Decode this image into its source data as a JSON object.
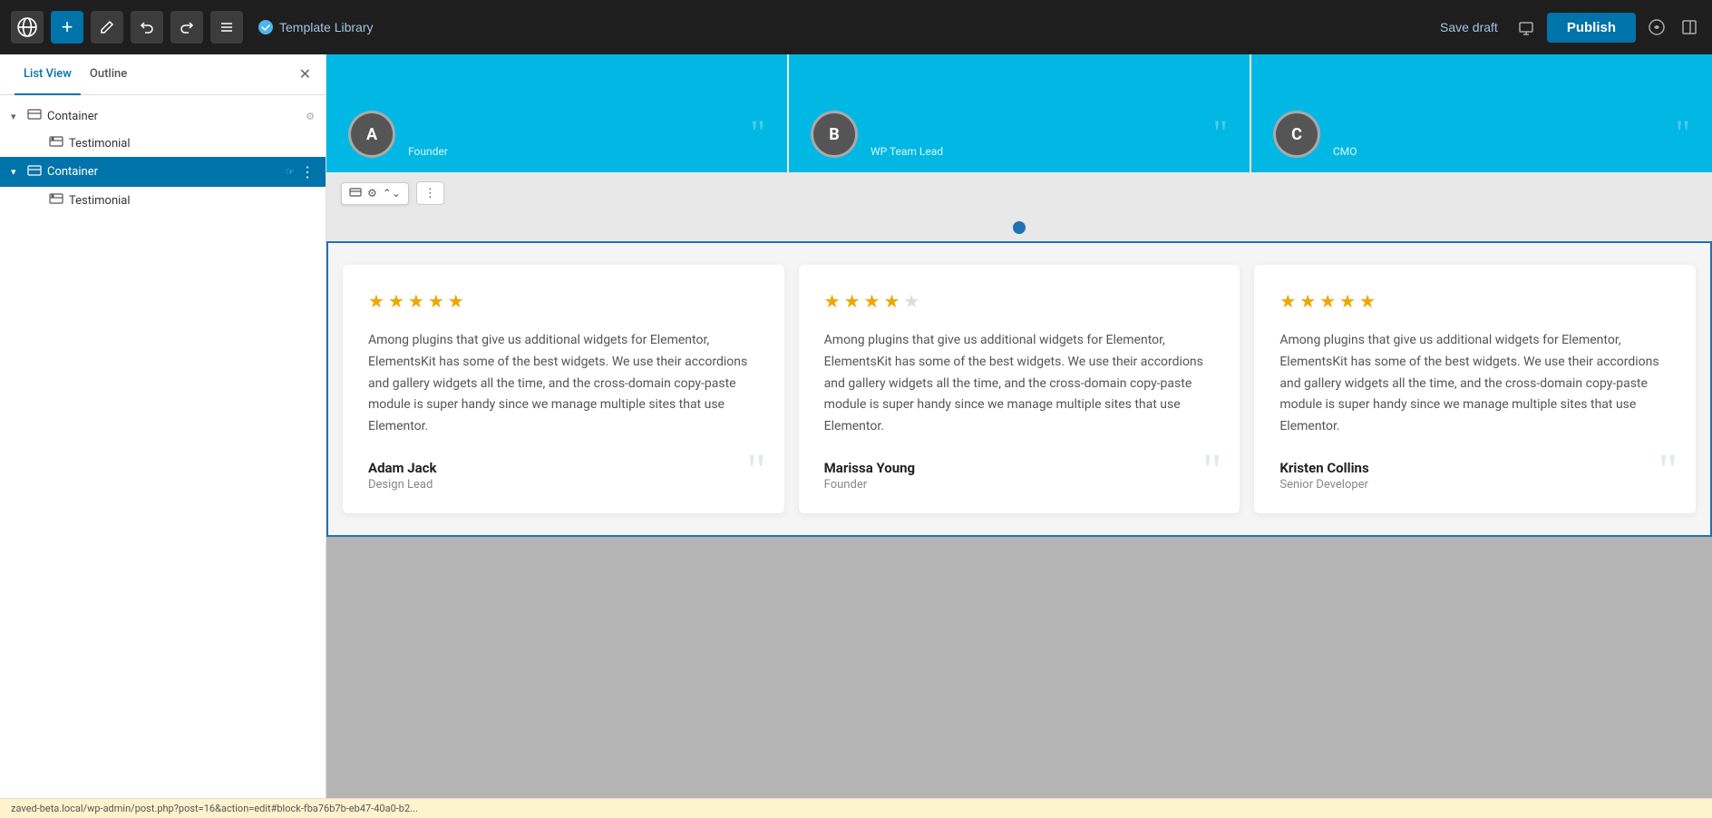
{
  "topbar": {
    "add_label": "+",
    "edit_label": "✎",
    "undo_label": "↩",
    "redo_label": "↪",
    "list_label": "≡",
    "template_library_label": "Template Library",
    "save_draft_label": "Save draft",
    "publish_label": "Publish",
    "responsive_icon": "🖥",
    "panel_icon": "⬜"
  },
  "sidebar": {
    "tab_list": "List View",
    "tab_outline": "Outline",
    "close_icon": "✕",
    "items": [
      {
        "id": "container-1",
        "label": "Container",
        "expanded": true,
        "selected": false,
        "indent": 0,
        "children": [
          {
            "id": "testimonial-1",
            "label": "Testimonial",
            "indent": 1
          }
        ]
      },
      {
        "id": "container-2",
        "label": "Container",
        "expanded": true,
        "selected": true,
        "indent": 0,
        "children": [
          {
            "id": "testimonial-2",
            "label": "Testimonial",
            "indent": 1
          }
        ]
      }
    ]
  },
  "cyan_cards": [
    {
      "id": "card-1",
      "role": "Founder",
      "initials": "A"
    },
    {
      "id": "card-2",
      "role": "WP Team Lead",
      "initials": "B"
    },
    {
      "id": "card-3",
      "role": "CMO",
      "initials": "C"
    }
  ],
  "testimonials": [
    {
      "id": "t1",
      "stars": 5,
      "text": "Among plugins that give us additional widgets for Elementor, ElementsKit has some of the best widgets. We use their accordions and gallery widgets all the time, and the cross-domain copy-paste module is super handy since we manage multiple sites that use Elementor.",
      "author": "Adam Jack",
      "role": "Design Lead"
    },
    {
      "id": "t2",
      "stars": 4,
      "text": "Among plugins that give us additional widgets for Elementor, ElementsKit has some of the best widgets. We use their accordions and gallery widgets all the time, and the cross-domain copy-paste module is super handy since we manage multiple sites that use Elementor.",
      "author": "Marissa Young",
      "role": "Founder"
    },
    {
      "id": "t3",
      "stars": 5,
      "text": "Among plugins that give us additional widgets for Elementor, ElementsKit has some of the best widgets. We use their accordions and gallery widgets all the time, and the cross-domain copy-paste module is super handy since we manage multiple sites that use Elementor.",
      "author": "Kristen Collins",
      "role": "Senior Developer"
    }
  ],
  "status_bar": {
    "url": "zaved-beta.local/wp-admin/post.php?post=16&action=edit#block-fba76b7b-eb47-40a0-b2..."
  }
}
